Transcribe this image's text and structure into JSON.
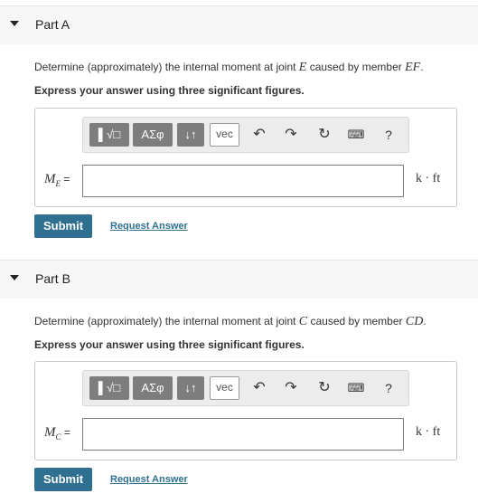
{
  "parts": [
    {
      "title": "Part A",
      "question_prefix": "Determine (approximately) the internal moment at joint ",
      "question_joint": "E",
      "question_middle": " caused by member ",
      "question_member": "EF",
      "question_suffix": ".",
      "instruction": "Express your answer using three significant figures.",
      "variable": "M",
      "variable_sub": "E",
      "equals": " =",
      "unit": "k · ft",
      "input_value": "",
      "submit_label": "Submit",
      "request_label": "Request Answer"
    },
    {
      "title": "Part B",
      "question_prefix": "Determine (approximately) the internal moment at joint ",
      "question_joint": "C",
      "question_middle": " caused by member ",
      "question_member": "CD",
      "question_suffix": ".",
      "instruction": "Express your answer using three significant figures.",
      "variable": "M",
      "variable_sub": "C",
      "equals": " =",
      "unit": "k · ft",
      "input_value": "",
      "submit_label": "Submit",
      "request_label": "Request Answer"
    }
  ],
  "toolbar": {
    "templates_label": "▌√□",
    "greek_label": "ΑΣφ",
    "arrows_label": "↓↑",
    "vec_label": "vec",
    "undo_icon": "↶",
    "redo_icon": "↷",
    "reset_icon": "↻",
    "keyboard_icon": "⌨",
    "help_label": "?"
  }
}
